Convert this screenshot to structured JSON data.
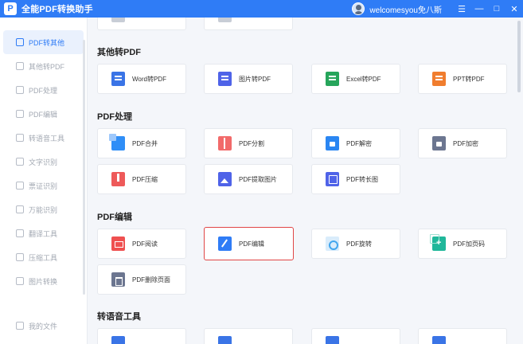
{
  "titlebar": {
    "logo_letter": "P",
    "title": "全能PDF转换助手",
    "username": "welcomesyou免八斯",
    "buttons": [
      "☰",
      "—",
      "□",
      "✕"
    ]
  },
  "sidebar": {
    "items": [
      {
        "label": "PDF转其他",
        "icon": "pdf-convert-icon",
        "active": true
      },
      {
        "label": "其他转PDF",
        "icon": "to-pdf-icon"
      },
      {
        "label": "PDF处理",
        "icon": "pdf-process-icon"
      },
      {
        "label": "PDF编辑",
        "icon": "pdf-edit-icon"
      },
      {
        "label": "转语音工具",
        "icon": "voice-icon"
      },
      {
        "label": "文字识别",
        "icon": "text-ocr-icon"
      },
      {
        "label": "票证识别",
        "icon": "ticket-icon"
      },
      {
        "label": "万能识别",
        "icon": "universal-ocr-icon"
      },
      {
        "label": "翻译工具",
        "icon": "translate-icon"
      },
      {
        "label": "压缩工具",
        "icon": "compress-icon"
      },
      {
        "label": "图片转换",
        "icon": "image-convert-icon"
      }
    ],
    "bottom_label": "我的文件"
  },
  "sections": {
    "other_to_pdf": {
      "title": "其他转PDF",
      "cards": [
        "Word转PDF",
        "图片转PDF",
        "Excel转PDF",
        "PPT转PDF"
      ]
    },
    "pdf_process": {
      "title": "PDF处理",
      "cards": [
        "PDF合并",
        "PDF分割",
        "PDF解密",
        "PDF加密",
        "PDF压缩",
        "PDF提取图片",
        "PDF转长图"
      ]
    },
    "pdf_edit": {
      "title": "PDF编辑",
      "cards": [
        "PDF阅读",
        "PDF编辑",
        "PDF旋转",
        "PDF加页码",
        "PDF删除页面"
      ]
    },
    "voice_tools": {
      "title": "转语音工具"
    }
  }
}
